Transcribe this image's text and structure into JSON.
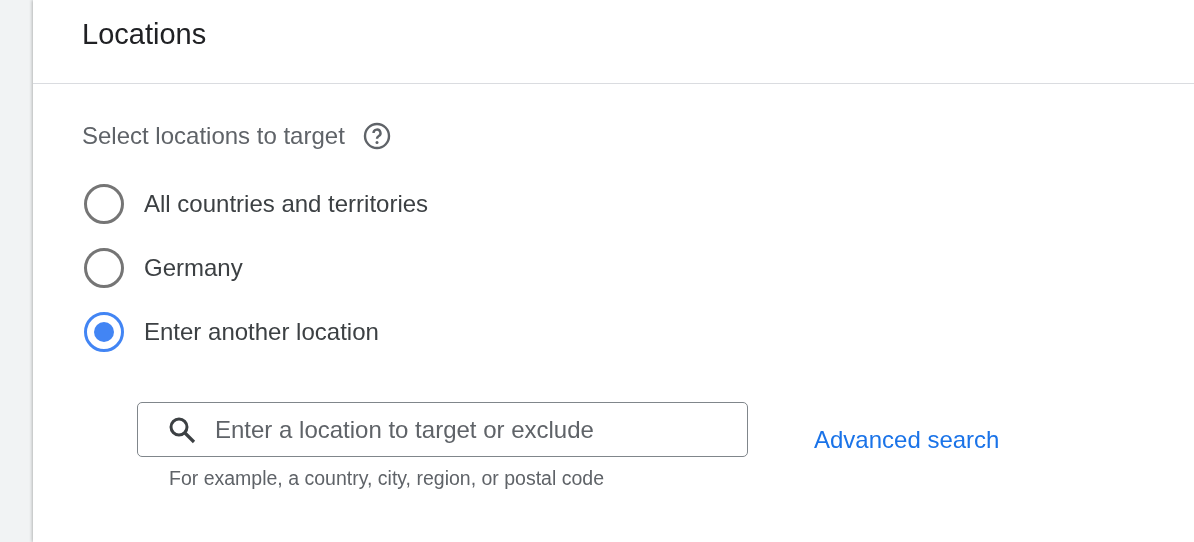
{
  "panel": {
    "title": "Locations"
  },
  "section": {
    "label": "Select locations to target"
  },
  "options": [
    {
      "label": "All countries and territories",
      "selected": false
    },
    {
      "label": "Germany",
      "selected": false
    },
    {
      "label": "Enter another location",
      "selected": true
    }
  ],
  "search": {
    "placeholder": "Enter a location to target or exclude",
    "hint": "For example, a country, city, region, or postal code"
  },
  "advanced_link": "Advanced search"
}
